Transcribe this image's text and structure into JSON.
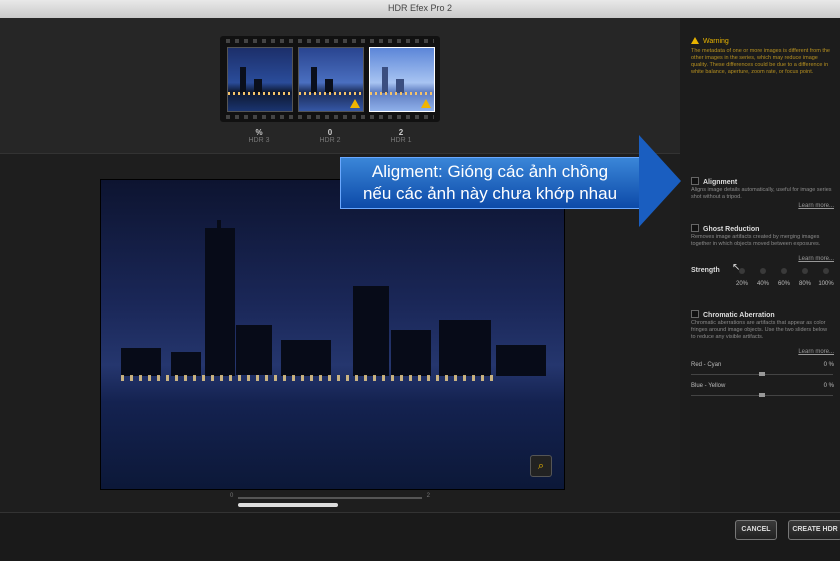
{
  "window": {
    "title": "HDR Efex Pro 2"
  },
  "exposures": [
    {
      "value": "%",
      "label": "HDR 3",
      "warning": false
    },
    {
      "value": "0",
      "label": "HDR 2",
      "warning": true
    },
    {
      "value": "2",
      "label": "HDR 1",
      "warning": true
    }
  ],
  "warning": {
    "title": "Warning",
    "text": "The metadata of one or more images is different from the other images in the series, which may reduce image quality. These differences could be due to a difference in white balance, aperture, zoom rate, or focus point."
  },
  "alignment": {
    "title": "Alignment",
    "desc": "Aligns image details automatically, useful for image series shot without a tripod.",
    "learn": "Learn more...",
    "checked": true
  },
  "ghost": {
    "title": "Ghost Reduction",
    "desc": "Removes image artifacts created by merging images together in which objects moved between exposures.",
    "learn": "Learn more...",
    "strength_label": "Strength",
    "levels": [
      "20%",
      "40%",
      "60%",
      "80%",
      "100%"
    ]
  },
  "chromatic": {
    "title": "Chromatic Aberration",
    "desc": "Chromatic aberrations are artifacts that appear as color fringes around image objects. Use the two sliders below to reduce any visible artifacts.",
    "learn": "Learn more...",
    "red_cyan": {
      "label": "Red - Cyan",
      "value": "0 %",
      "fraction": 0.5
    },
    "blue_yellow": {
      "label": "Blue - Yellow",
      "value": "0 %",
      "fraction": 0.5
    }
  },
  "scrubber": {
    "min_label": "0",
    "max_label": "2"
  },
  "buttons": {
    "cancel": "CANCEL",
    "create": "CREATE HDR"
  },
  "callout": {
    "line1": "Aligment: Gióng các ảnh chồng",
    "line2": "nếu các ảnh này chưa khớp nhau"
  },
  "colors": {
    "accent_warning": "#e8b400",
    "callout_blue": "#1a5ec0"
  },
  "icons": {
    "zoom": "magnifier-icon",
    "warning": "warning-triangle-icon"
  }
}
